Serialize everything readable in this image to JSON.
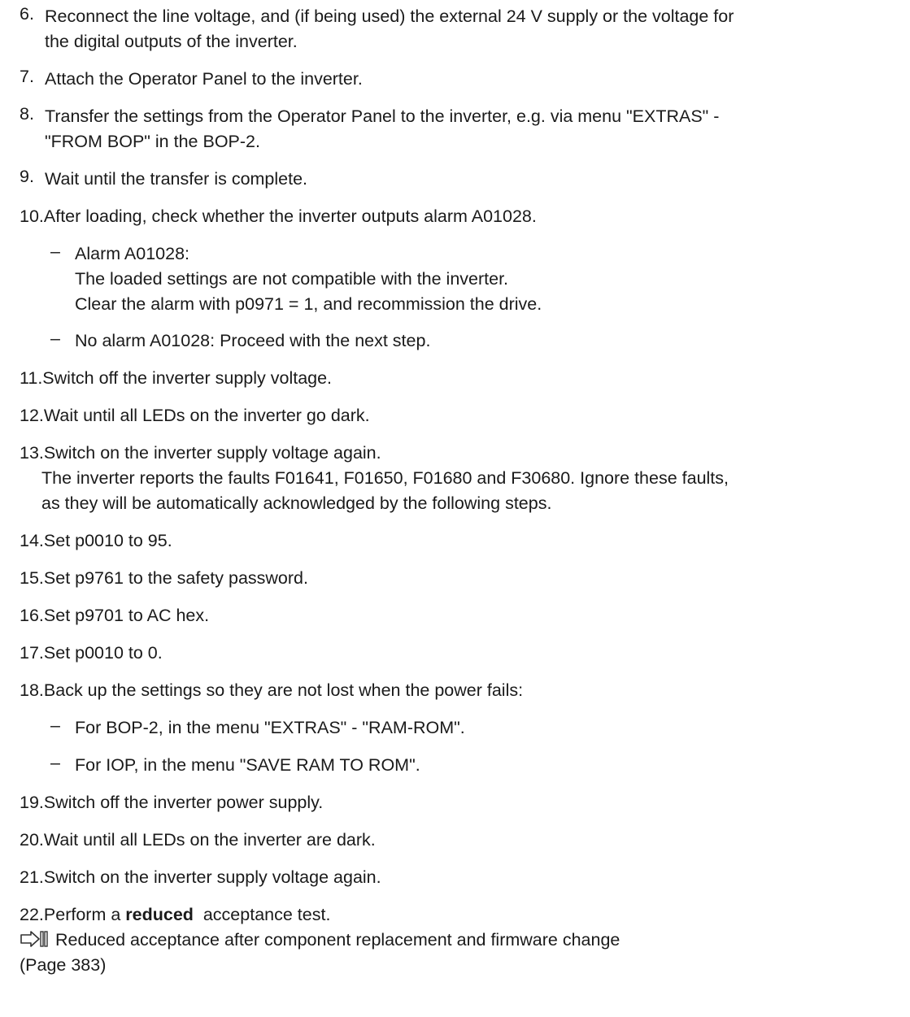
{
  "steps": {
    "s6": {
      "num": "6.",
      "line1": "Reconnect the line voltage, and (if being used) the external 24 V supply or the voltage for",
      "line2": "the digital outputs of the inverter."
    },
    "s7": {
      "num": "7.",
      "line1": "Attach the Operator Panel to the inverter."
    },
    "s8": {
      "num": "8.",
      "line1": "Transfer the settings from the Operator Panel to the inverter, e.g. via menu \"EXTRAS\" -",
      "line2": "\"FROM BOP\" in the BOP-2."
    },
    "s9": {
      "num": "9.",
      "line1": "Wait until the transfer is complete."
    },
    "s10": {
      "num": "10.",
      "line1": "After loading, check whether the inverter outputs alarm A01028.",
      "sub1": {
        "dash": "–",
        "line1": "Alarm A01028:",
        "line2": "The loaded settings are not compatible with the inverter.",
        "line3": "Clear the alarm with p0971 = 1, and recommission the drive."
      },
      "sub2": {
        "dash": "–",
        "line1": "No alarm A01028: Proceed with the next step."
      }
    },
    "s11": {
      "num": "11.",
      "line1": "Switch off the inverter supply voltage."
    },
    "s12": {
      "num": "12.",
      "line1": "Wait until all LEDs on the inverter go dark."
    },
    "s13": {
      "num": "13.",
      "line1": "Switch on the inverter supply voltage again.",
      "line2": "The inverter reports the faults F01641, F01650, F01680 and F30680. Ignore these faults,",
      "line3": "as they will be automatically acknowledged by the following steps."
    },
    "s14": {
      "num": "14.",
      "line1": "Set p0010 to 95."
    },
    "s15": {
      "num": "15.",
      "line1": "Set p9761 to the safety password."
    },
    "s16": {
      "num": "16.",
      "line1": "Set p9701 to AC hex."
    },
    "s17": {
      "num": "17.",
      "line1": "Set p0010 to 0."
    },
    "s18": {
      "num": "18.",
      "line1": "Back up the settings so they are not lost when the power fails:",
      "sub1": {
        "dash": "–",
        "line1": "For BOP-2, in the menu \"EXTRAS\" - \"RAM-ROM\"."
      },
      "sub2": {
        "dash": "–",
        "line1": "For IOP, in the menu \"SAVE RAM TO ROM\"."
      }
    },
    "s19": {
      "num": "19.",
      "line1": "Switch off the inverter power supply."
    },
    "s20": {
      "num": "20.",
      "line1": "Wait until all LEDs on the inverter are dark."
    },
    "s21": {
      "num": "21.",
      "line1": "Switch on the inverter supply voltage again."
    },
    "s22": {
      "num": "22.",
      "pre": "Perform a ",
      "bold": "reduced",
      "post": "  acceptance test.",
      "link_text": "Reduced acceptance after component replacement and firmware change",
      "link_page": "(Page 383)",
      "link_icon": "cross-reference-icon"
    }
  }
}
